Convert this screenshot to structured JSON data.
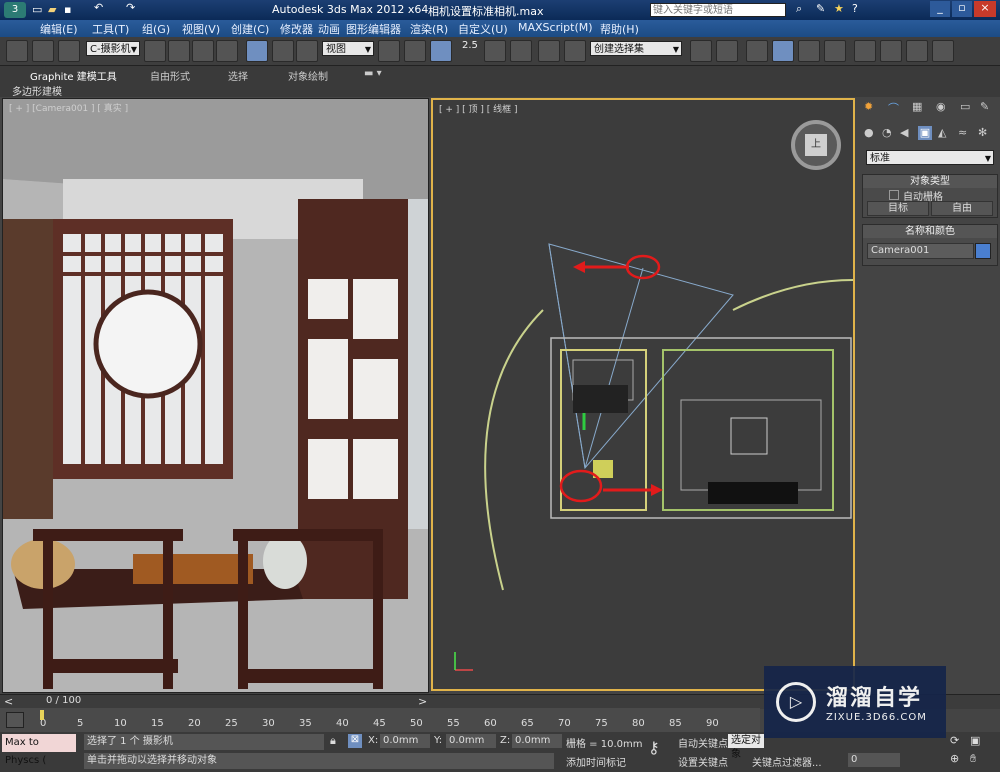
{
  "title": {
    "app": "Autodesk 3ds Max  2012 x64",
    "file": "相机设置标准相机.max",
    "search_placeholder": "键入关键字或短语"
  },
  "menu": [
    "编辑(E)",
    "工具(T)",
    "组(G)",
    "视图(V)",
    "创建(C)",
    "修改器",
    "动画",
    "图形编辑器",
    "渲染(R)",
    "自定义(U)",
    "MAXScript(M)",
    "帮助(H)"
  ],
  "toolbar": {
    "selection_filter": "C-摄影机",
    "reference_coord": "视图",
    "named_selection": "创建选择集",
    "snap_angle": "2.5"
  },
  "ribbon": {
    "tabs": [
      "Graphite 建模工具",
      "自由形式",
      "选择",
      "对象绘制"
    ],
    "sub": "多边形建模"
  },
  "viewports": {
    "left_label": "[ + ] [Camera001 ] [ 真实 ]",
    "right_label": "[ + ] [ 顶 ] [ 线框 ]",
    "viewcube_label": "上"
  },
  "command_panel": {
    "category": "标准",
    "object_type_title": "对象类型",
    "auto_grid": "自动栅格",
    "btn_target": "目标",
    "btn_free": "自由",
    "name_color_title": "名称和颜色",
    "object_name": "Camera001",
    "object_color": "#4a7fd0"
  },
  "timeline": {
    "frame_display": "0 / 100",
    "ticks": [
      "0",
      "5",
      "10",
      "15",
      "20",
      "25",
      "30",
      "35",
      "40",
      "45",
      "50",
      "55",
      "60",
      "65",
      "70",
      "75",
      "80",
      "85",
      "90"
    ]
  },
  "status": {
    "maxscript": "Max to Physcs (",
    "selected": "选择了 1 个 摄影机",
    "hint": "单击并拖动以选择并移动对象",
    "x_label": "X:",
    "x_val": "0.0mm",
    "y_label": "Y:",
    "y_val": "0.0mm",
    "z_label": "Z:",
    "z_val": "0.0mm",
    "grid": "栅格 = 10.0mm",
    "add_time_tag": "添加时间标记",
    "auto_key": "自动关键点",
    "set_key": "设置关键点",
    "selected_obj": "选定对象",
    "key_filters": "关键点过滤器...",
    "frame_field": "0"
  },
  "watermark": {
    "brand": "溜溜自学",
    "url": "ZIXUE.3D66.COM"
  }
}
